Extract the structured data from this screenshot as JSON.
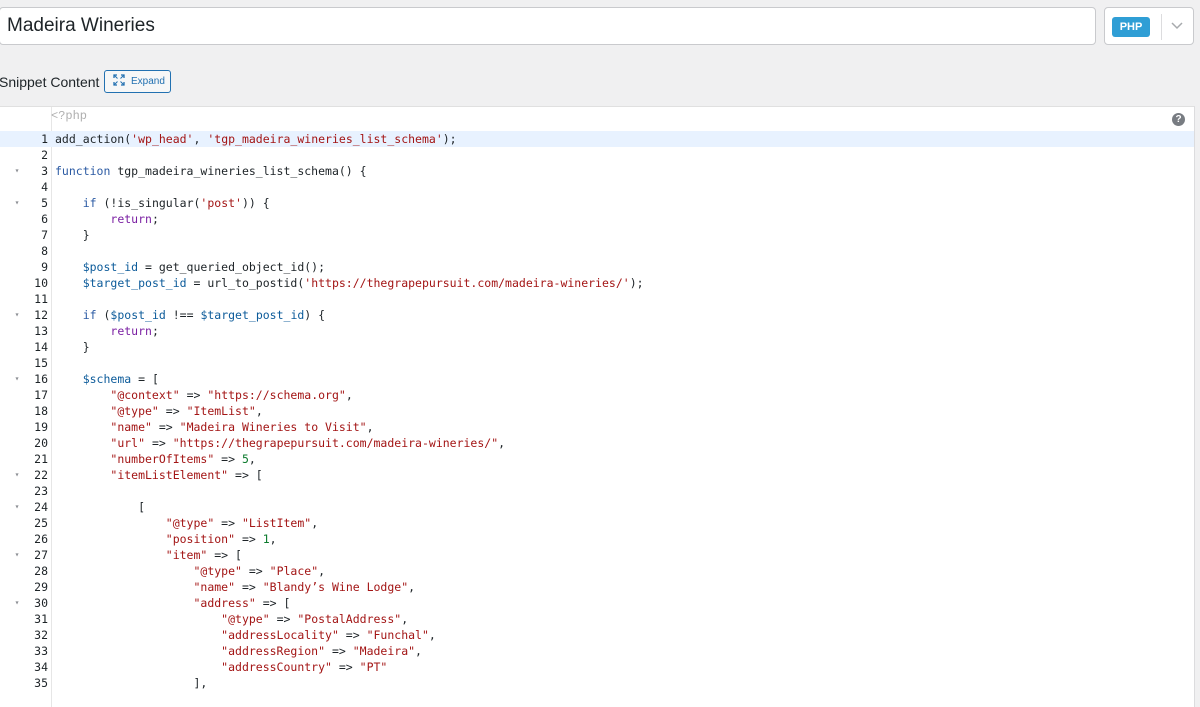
{
  "title": "Madeira Wineries",
  "language_badge": "PHP",
  "section_label": "Snippet Content",
  "expand_label": "Expand",
  "php_open_tag": "<?php",
  "help_symbol": "?",
  "icons": [
    "chevron-down-icon",
    "expand-icon",
    "help-icon",
    "fold-arrow-icon"
  ],
  "colors": {
    "accent": "#2271b1",
    "badge": "#2f9ed5",
    "active_line": "#e8f2ff"
  },
  "code_lines": [
    {
      "n": "1",
      "fold": false,
      "html": "add_action(<span class=\"s\">'wp_head'</span>, <span class=\"s\">'tgp_madeira_wineries_list_schema'</span>);"
    },
    {
      "n": "2",
      "fold": false,
      "html": ""
    },
    {
      "n": "3",
      "fold": true,
      "html": "<span class=\"k2\">function</span> tgp_madeira_wineries_list_schema() {"
    },
    {
      "n": "4",
      "fold": false,
      "html": ""
    },
    {
      "n": "5",
      "fold": true,
      "html": "    <span class=\"k2\">if</span> (!is_singular(<span class=\"s\">'post'</span>)) {"
    },
    {
      "n": "6",
      "fold": false,
      "html": "        <span class=\"k\">return</span>;"
    },
    {
      "n": "7",
      "fold": false,
      "html": "    }"
    },
    {
      "n": "8",
      "fold": false,
      "html": ""
    },
    {
      "n": "9",
      "fold": false,
      "html": "    <span class=\"v\">$post_id</span> = get_queried_object_id();"
    },
    {
      "n": "10",
      "fold": false,
      "html": "    <span class=\"v\">$target_post_id</span> = url_to_postid(<span class=\"s\">'https://thegrapepursuit.com/madeira-wineries/'</span>);"
    },
    {
      "n": "11",
      "fold": false,
      "html": ""
    },
    {
      "n": "12",
      "fold": true,
      "html": "    <span class=\"k2\">if</span> (<span class=\"v\">$post_id</span> !== <span class=\"v\">$target_post_id</span>) {"
    },
    {
      "n": "13",
      "fold": false,
      "html": "        <span class=\"k\">return</span>;"
    },
    {
      "n": "14",
      "fold": false,
      "html": "    }"
    },
    {
      "n": "15",
      "fold": false,
      "html": ""
    },
    {
      "n": "16",
      "fold": true,
      "html": "    <span class=\"v\">$schema</span> = ["
    },
    {
      "n": "17",
      "fold": false,
      "html": "        <span class=\"s\">\"@context\"</span> => <span class=\"s\">\"https://schema.org\"</span>,"
    },
    {
      "n": "18",
      "fold": false,
      "html": "        <span class=\"s\">\"@type\"</span> => <span class=\"s\">\"ItemList\"</span>,"
    },
    {
      "n": "19",
      "fold": false,
      "html": "        <span class=\"s\">\"name\"</span> => <span class=\"s\">\"Madeira Wineries to Visit\"</span>,"
    },
    {
      "n": "20",
      "fold": false,
      "html": "        <span class=\"s\">\"url\"</span> => <span class=\"s\">\"https://thegrapepursuit.com/madeira-wineries/\"</span>,"
    },
    {
      "n": "21",
      "fold": false,
      "html": "        <span class=\"s\">\"numberOfItems\"</span> => <span class=\"n\">5</span>,"
    },
    {
      "n": "22",
      "fold": true,
      "html": "        <span class=\"s\">\"itemListElement\"</span> => ["
    },
    {
      "n": "23",
      "fold": false,
      "html": ""
    },
    {
      "n": "24",
      "fold": true,
      "html": "            ["
    },
    {
      "n": "25",
      "fold": false,
      "html": "                <span class=\"s\">\"@type\"</span> => <span class=\"s\">\"ListItem\"</span>,"
    },
    {
      "n": "26",
      "fold": false,
      "html": "                <span class=\"s\">\"position\"</span> => <span class=\"n\">1</span>,"
    },
    {
      "n": "27",
      "fold": true,
      "html": "                <span class=\"s\">\"item\"</span> => ["
    },
    {
      "n": "28",
      "fold": false,
      "html": "                    <span class=\"s\">\"@type\"</span> => <span class=\"s\">\"Place\"</span>,"
    },
    {
      "n": "29",
      "fold": false,
      "html": "                    <span class=\"s\">\"name\"</span> => <span class=\"s\">\"Blandy’s Wine Lodge\"</span>,"
    },
    {
      "n": "30",
      "fold": true,
      "html": "                    <span class=\"s\">\"address\"</span> => ["
    },
    {
      "n": "31",
      "fold": false,
      "html": "                        <span class=\"s\">\"@type\"</span> => <span class=\"s\">\"PostalAddress\"</span>,"
    },
    {
      "n": "32",
      "fold": false,
      "html": "                        <span class=\"s\">\"addressLocality\"</span> => <span class=\"s\">\"Funchal\"</span>,"
    },
    {
      "n": "33",
      "fold": false,
      "html": "                        <span class=\"s\">\"addressRegion\"</span> => <span class=\"s\">\"Madeira\"</span>,"
    },
    {
      "n": "34",
      "fold": false,
      "html": "                        <span class=\"s\">\"addressCountry\"</span> => <span class=\"s\">\"PT\"</span>"
    },
    {
      "n": "35",
      "fold": false,
      "html": "                    ],"
    }
  ]
}
